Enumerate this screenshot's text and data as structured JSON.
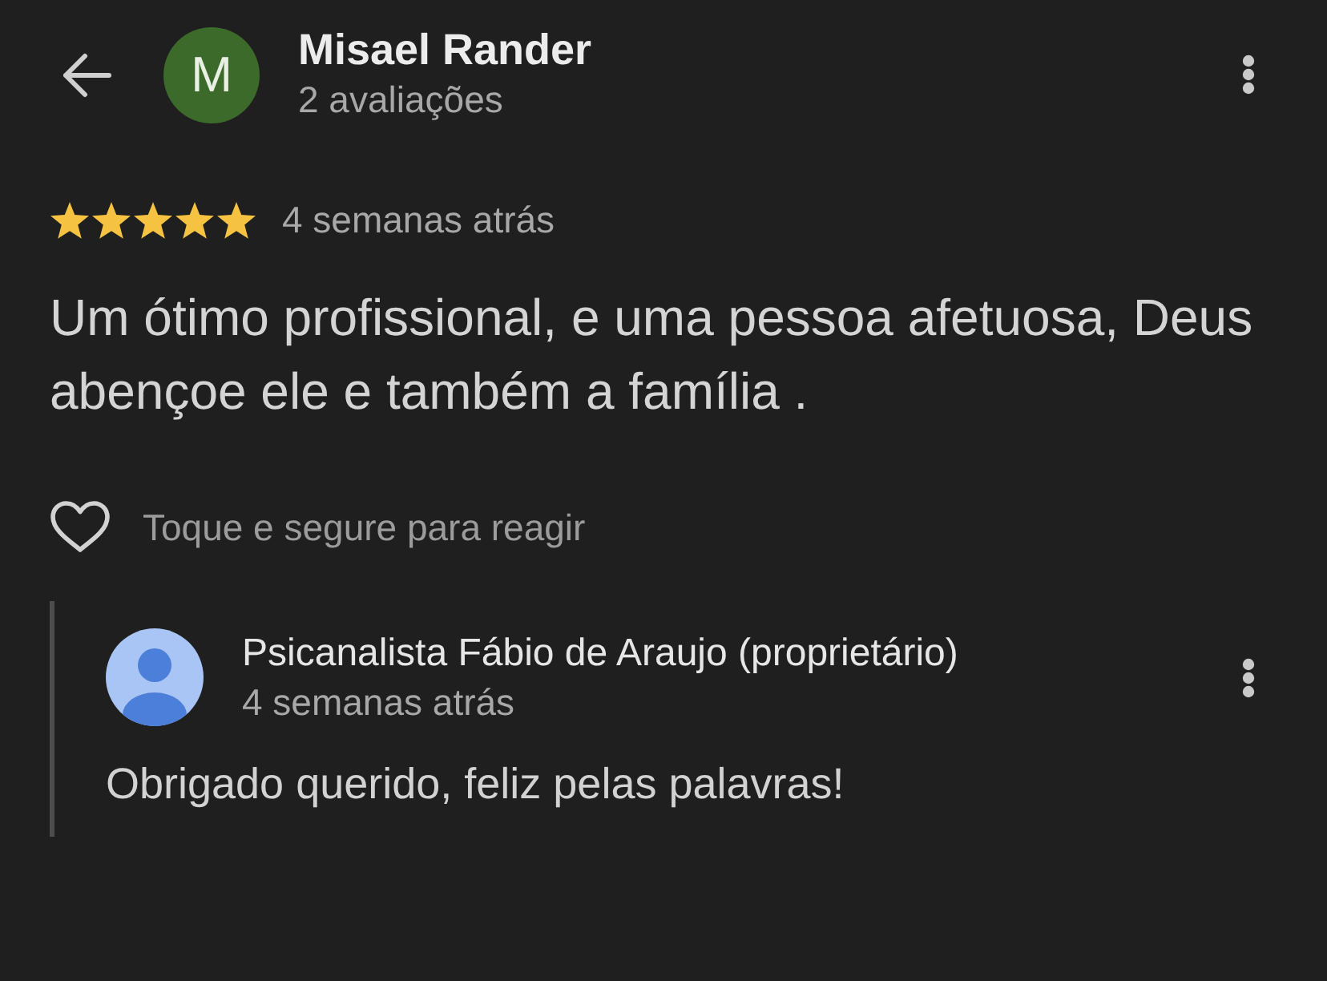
{
  "reviewer": {
    "initial": "M",
    "name": "Misael Rander",
    "review_count": "2 avaliações"
  },
  "review": {
    "stars": 5,
    "time": "4 semanas atrás",
    "text": "Um ótimo profissional, e uma pessoa afetuosa, Deus abençoe ele e também a família ."
  },
  "reaction": {
    "hint": "Toque e segure para reagir"
  },
  "owner_reply": {
    "name": "Psicanalista Fábio de Araujo (proprietário)",
    "time": "4 semanas atrás",
    "text": "Obrigado querido, feliz pelas palavras!"
  }
}
